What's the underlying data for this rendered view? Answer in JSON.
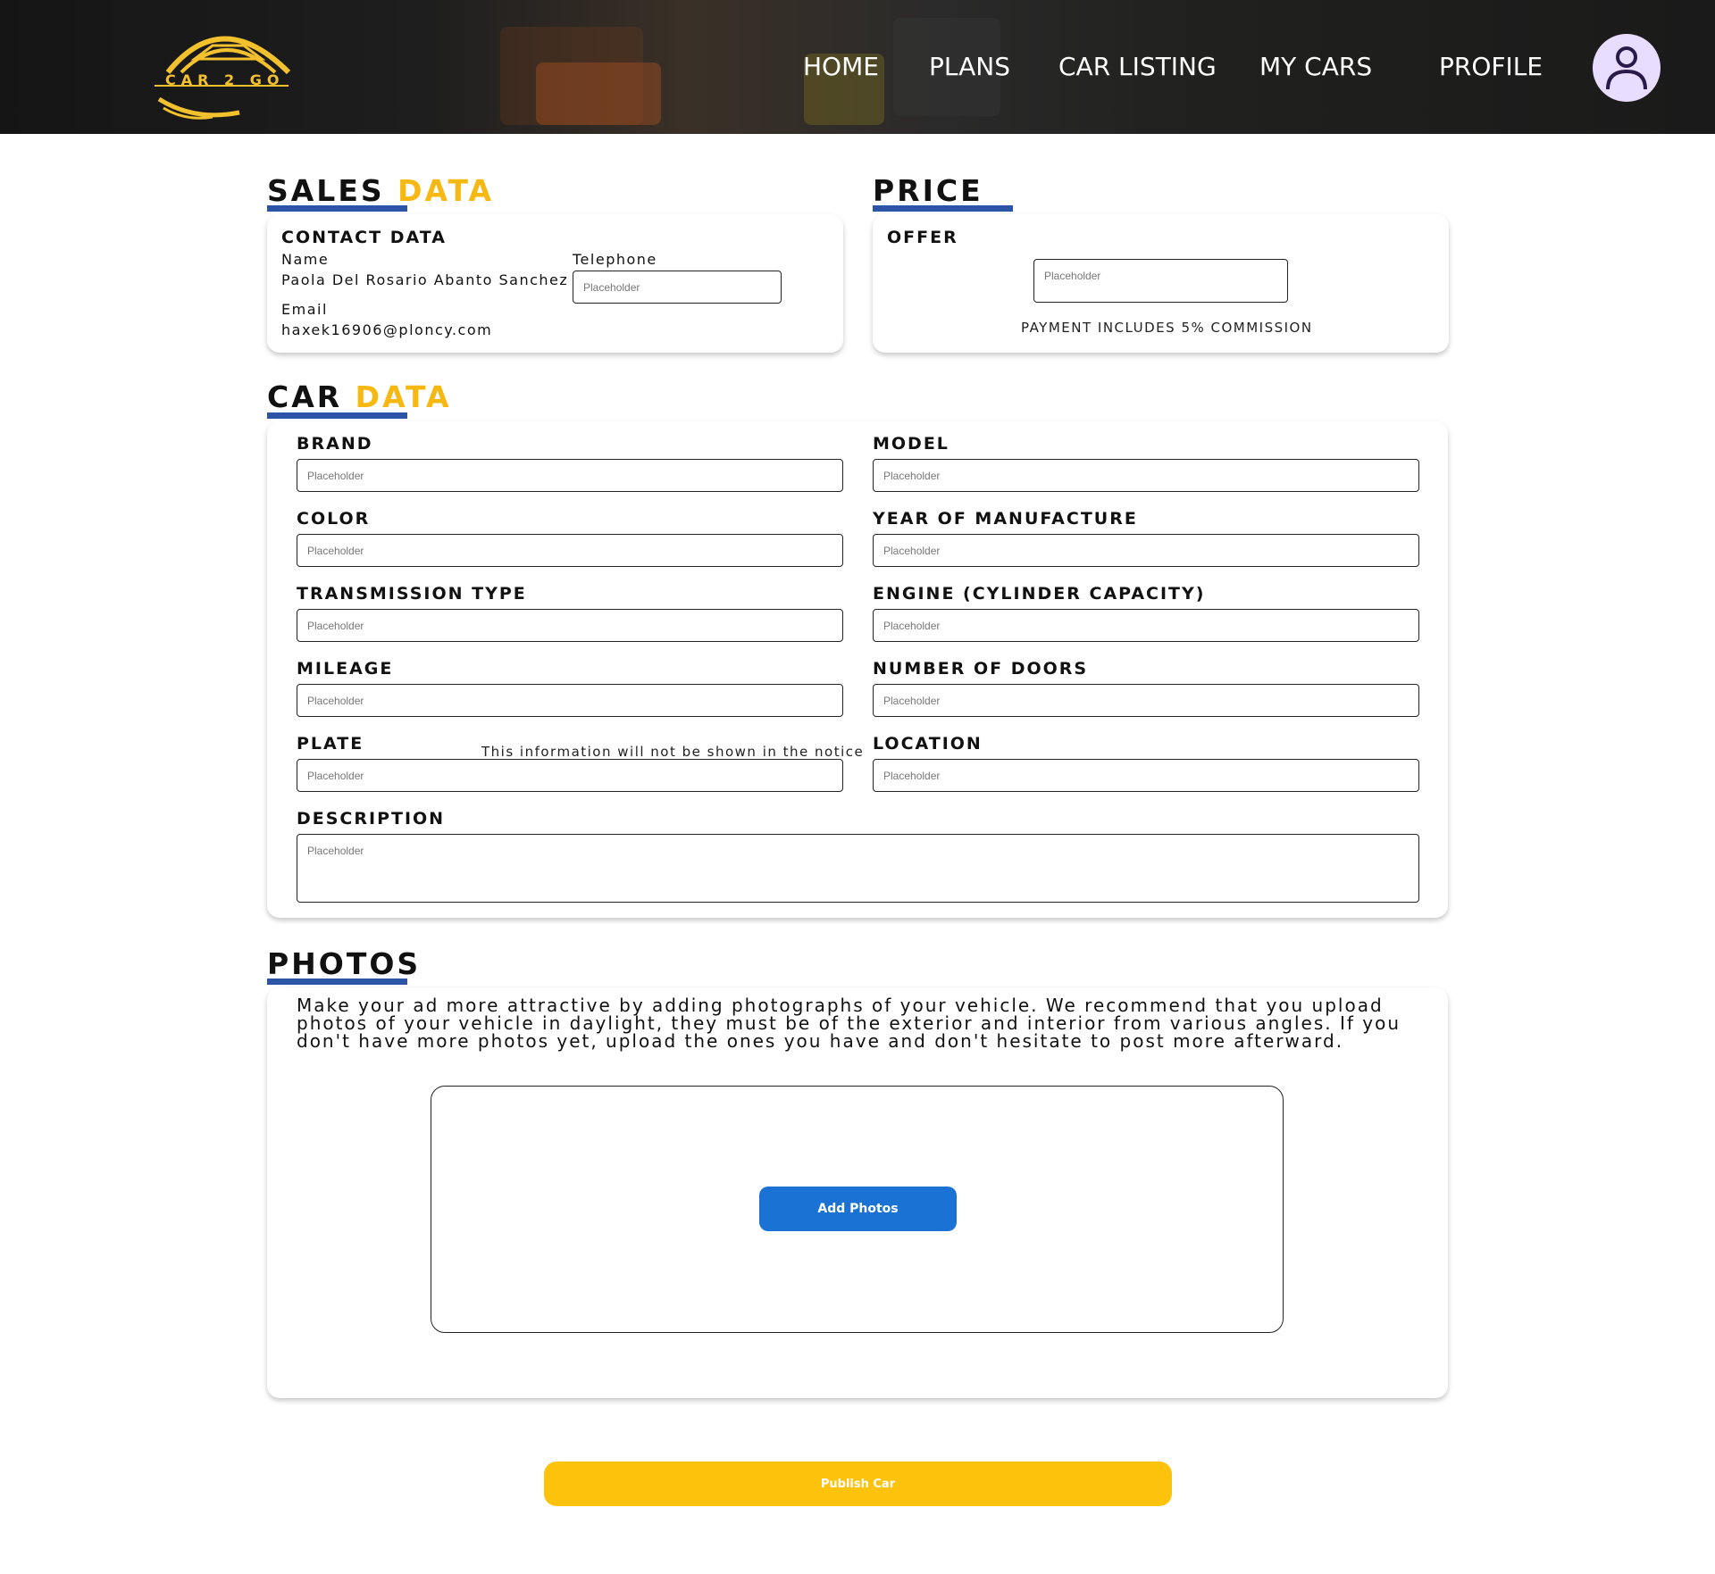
{
  "brand": {
    "name": "CAR 2 GO",
    "color": "#f3c12e"
  },
  "nav": {
    "home": "HOME",
    "plans": "PLANS",
    "car_listing": "CAR LISTING",
    "my_cars": "MY CARS",
    "profile": "PROFILE",
    "avatar_icon": "user-icon"
  },
  "sales": {
    "title": "SALES",
    "title_accent": "DATA",
    "contact_heading": "CONTACT DATA",
    "name_label": "Name",
    "name_value": "Paola Del Rosario Abanto Sanchez",
    "email_label": "Email",
    "email_value": "haxek16906@ploncy.com",
    "telephone_label": "Telephone",
    "telephone_placeholder": "Placeholder"
  },
  "price": {
    "title": "PRICE",
    "offer_label": "OFFER",
    "offer_placeholder": "Placeholder",
    "note": "PAYMENT INCLUDES 5% COMMISSION"
  },
  "car": {
    "title": "CAR",
    "title_accent": "DATA",
    "brand_label": "BRAND",
    "model_label": "MODEL",
    "color_label": "COLOR",
    "year_label": "YEAR OF MANUFACTURE",
    "transmission_label": "TRANSMISSION TYPE",
    "engine_label": "ENGINE (CYLINDER CAPACITY)",
    "mileage_label": "MILEAGE",
    "doors_label": "NUMBER OF DOORS",
    "plate_label": "PLATE",
    "plate_note": "This information will not be shown in the notice",
    "location_label": "LOCATION",
    "description_label": "DESCRIPTION",
    "placeholder": "Placeholder"
  },
  "photos": {
    "title": "PHOTOS",
    "text": "Make your ad more attractive by adding photographs of your vehicle. We recommend that you upload photos of your vehicle in daylight, they must be of the exterior and interior from various angles. If you don't have more photos yet, upload the ones you have and don't hesitate to post more afterward.",
    "add_button": "Add Photos"
  },
  "publish_button": "Publish Car",
  "colors": {
    "accent_yellow": "#f6b913",
    "underline_blue": "#2c55a8",
    "add_button_blue": "#1a73d4",
    "publish_yellow": "#fdc20c"
  }
}
